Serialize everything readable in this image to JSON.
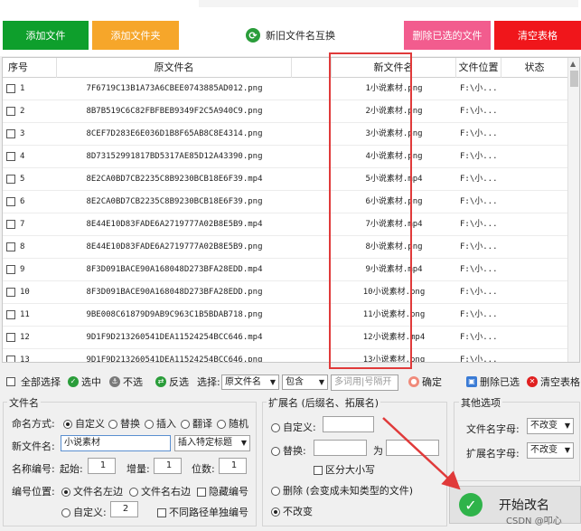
{
  "toolbar_top": {
    "add_file": "添加文件",
    "add_folder": "添加文件夹",
    "swap_names": "新旧文件名互换",
    "delete_selected_files": "删除已选的文件",
    "clear_table": "清空表格"
  },
  "columns": {
    "index": "序号",
    "original": "原文件名",
    "new": "新文件名",
    "location": "文件位置",
    "status": "状态"
  },
  "rows": [
    {
      "no": "1",
      "orig": "7F6719C13B1A73A6CBEE0743885AD012.png",
      "new": "1小说素材.png",
      "loc": "F:\\小..."
    },
    {
      "no": "2",
      "orig": "8B7B519C6C82FBFBEB9349F2C5A940C9.png",
      "new": "2小说素材.png",
      "loc": "F:\\小..."
    },
    {
      "no": "3",
      "orig": "8CEF7D283E6E036D1B8F65AB8C8E4314.png",
      "new": "3小说素材.png",
      "loc": "F:\\小..."
    },
    {
      "no": "4",
      "orig": "8D73152991817BD5317AE85D12A43390.png",
      "new": "4小说素材.png",
      "loc": "F:\\小..."
    },
    {
      "no": "5",
      "orig": "8E2CA0BD7CB2235C8B9230BCB18E6F39.mp4",
      "new": "5小说素材.mp4",
      "loc": "F:\\小..."
    },
    {
      "no": "6",
      "orig": "8E2CA0BD7CB2235C8B9230BCB18E6F39.png",
      "new": "6小说素材.png",
      "loc": "F:\\小..."
    },
    {
      "no": "7",
      "orig": "8E44E10D83FADE6A2719777A02B8E5B9.mp4",
      "new": "7小说素材.mp4",
      "loc": "F:\\小..."
    },
    {
      "no": "8",
      "orig": "8E44E10D83FADE6A2719777A02B8E5B9.png",
      "new": "8小说素材.png",
      "loc": "F:\\小..."
    },
    {
      "no": "9",
      "orig": "8F3D091BACE90A168048D273BFA28EDD.mp4",
      "new": "9小说素材.mp4",
      "loc": "F:\\小..."
    },
    {
      "no": "10",
      "orig": "8F3D091BACE90A168048D273BFA28EDD.png",
      "new": "10小说素材.png",
      "loc": "F:\\小..."
    },
    {
      "no": "11",
      "orig": "9BE008C61879D9AB9C963C1B5BDAB718.png",
      "new": "11小说素材.png",
      "loc": "F:\\小..."
    },
    {
      "no": "12",
      "orig": "9D1F9D213260541DEA11524254BCC646.mp4",
      "new": "12小说素材.mp4",
      "loc": "F:\\小..."
    },
    {
      "no": "13",
      "orig": "9D1F9D213260541DEA11524254BCC646.png",
      "new": "13小说素材.png",
      "loc": "F:\\小..."
    }
  ],
  "toolbar2": {
    "select_all": "全部选择",
    "select": "选中",
    "unselect": "不选",
    "invert": "反选",
    "choose_label": "选择:",
    "field_select": "原文件名",
    "mode_select": "包含",
    "keyword_placeholder": "多词用|号隔开",
    "confirm": "确定",
    "delete_selected": "删除已选",
    "clear_table": "清空表格"
  },
  "filename_panel": {
    "title": "文件名",
    "naming_label": "命名方式:",
    "mode_custom": "自定义",
    "mode_replace": "替换",
    "mode_insert": "插入",
    "mode_translate": "翻译",
    "mode_random": "随机",
    "new_name_label": "新文件名:",
    "new_name_value": "小说素材",
    "insert_title": "插入特定标题",
    "number_label": "名称编号:",
    "start_label": "起始:",
    "start_value": "1",
    "step_label": "增量:",
    "step_value": "1",
    "digits_label": "位数:",
    "digits_value": "1",
    "position_label": "编号位置:",
    "pos_left": "文件名左边",
    "pos_right": "文件名右边",
    "hide_number": "隐藏编号",
    "pos_custom": "自定义:",
    "custom_value": "2",
    "diff_path": "不同路径单独编号"
  },
  "ext_panel": {
    "title": "扩展名 (后缀名、拓展名)",
    "custom": "自定义:",
    "replace": "替换:",
    "to": "为",
    "case_sensitive": "区分大小写",
    "delete": "删除 (会变成未知类型的文件)",
    "keep": "不改变"
  },
  "other_panel": {
    "title": "其他选项",
    "name_case_label": "文件名字母:",
    "name_case_value": "不改变",
    "ext_case_label": "扩展名字母:",
    "ext_case_value": "不改变"
  },
  "start_button": "开始改名",
  "watermark": "CSDN @叩心",
  "colors": {
    "green": "#0e9f2c",
    "orange": "#f6a62a",
    "pink": "#f25c8e",
    "red": "#f0161b",
    "highlight": "#e03a3a"
  }
}
